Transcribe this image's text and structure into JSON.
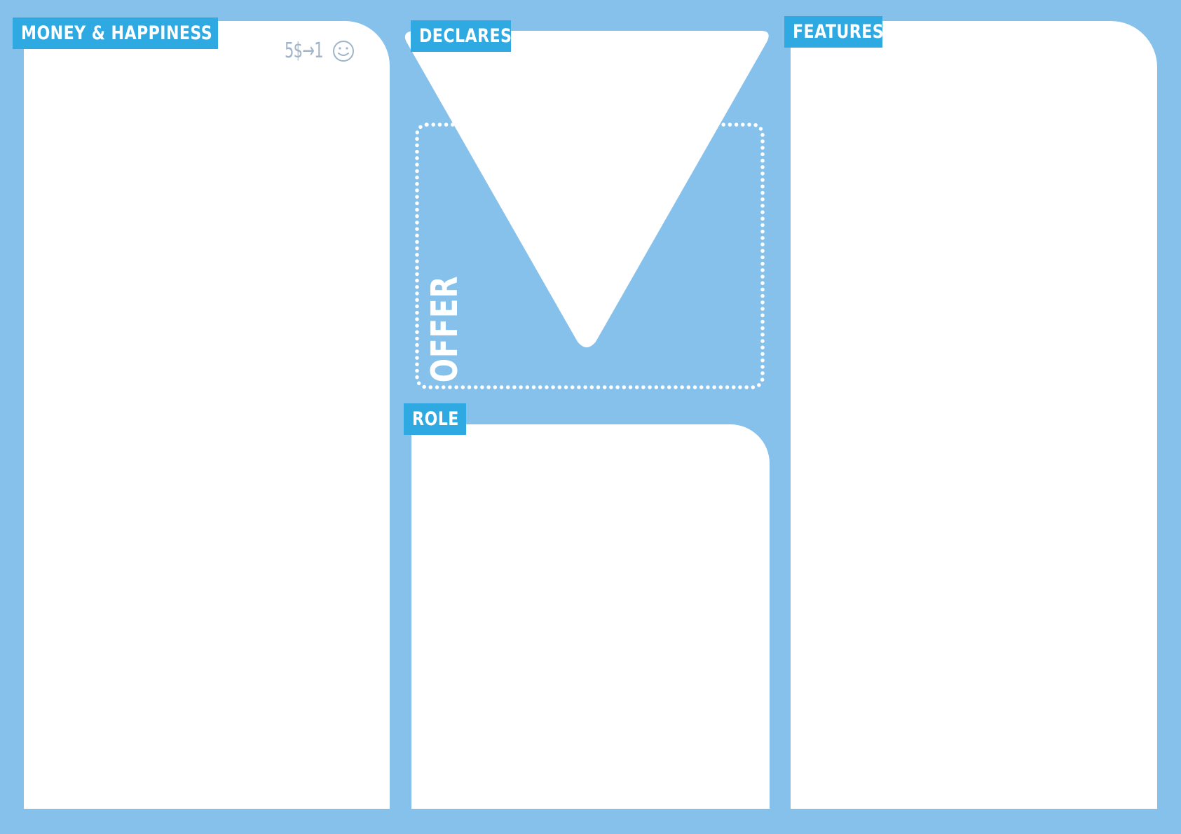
{
  "canvas": {
    "background": "#85c1eb",
    "tag_color": "#2fa9e1",
    "panel_color": "#ffffff"
  },
  "sections": {
    "money": {
      "label": "MONEY & HAPPINESS"
    },
    "declares": {
      "label": "DECLARES"
    },
    "offer": {
      "label": "OFFER"
    },
    "role": {
      "label": "ROLE"
    },
    "features": {
      "label": "FEATURES"
    }
  },
  "formula": {
    "text": "5$→1",
    "icon": "smiley-icon"
  }
}
